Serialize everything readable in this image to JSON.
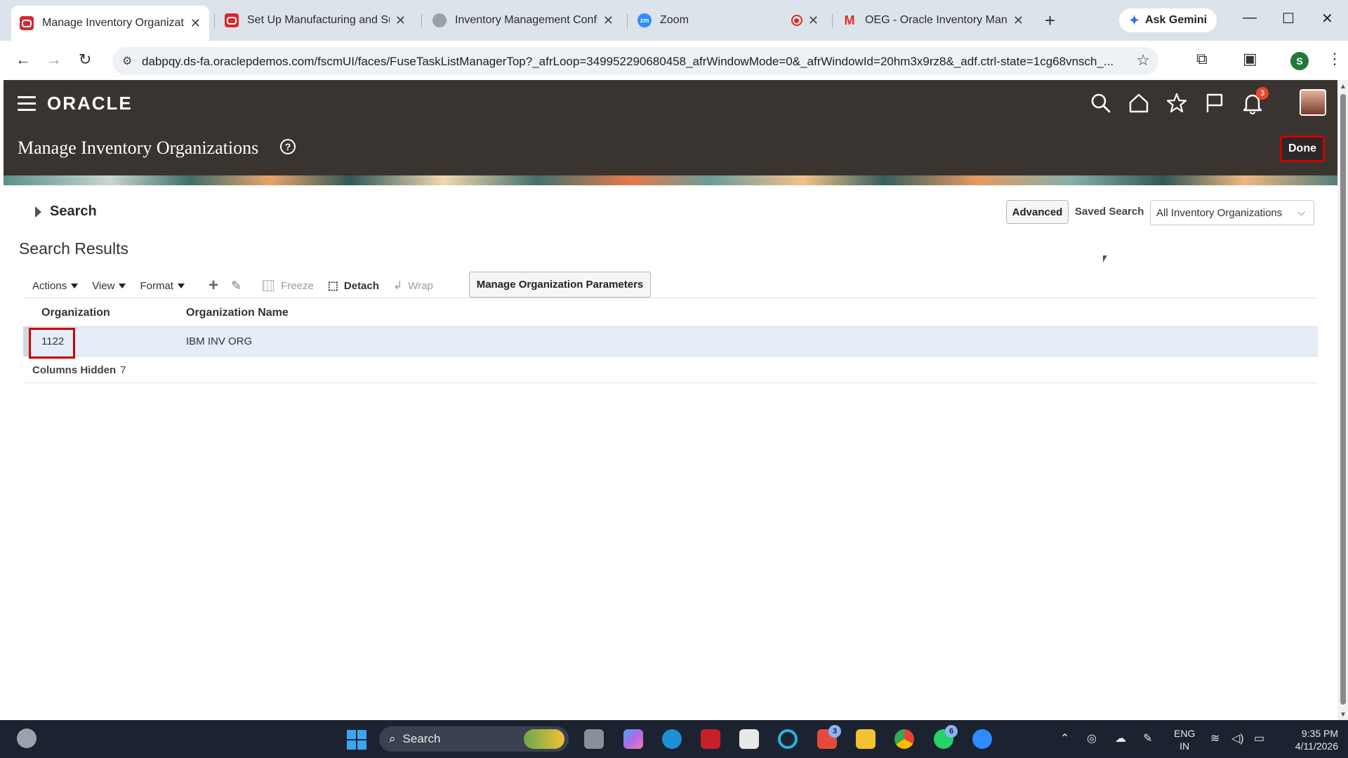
{
  "browser": {
    "tabs": [
      {
        "label": "Manage Inventory Organizatio",
        "active": true
      },
      {
        "label": "Set Up Manufacturing and Sup",
        "active": false
      },
      {
        "label": "Inventory Management Config",
        "active": false
      },
      {
        "label": "Zoom",
        "active": false
      },
      {
        "label": "OEG - Oracle Inventory Manag",
        "active": false
      }
    ],
    "close_glyph": "✕",
    "new_tab_glyph": "+",
    "gemini_label": "Ask Gemini",
    "url": "dabpqy.ds-fa.oraclepdemos.com/fscmUI/faces/FuseTaskListManagerTop?_afrLoop=349952290680458_afrWindowMode=0&_afrWindowId=20hm3x9rz8&_adf.ctrl-state=1cg68vnsch_...",
    "profile_initial": "S"
  },
  "oracle": {
    "logo": "ORACLE",
    "notification_count": "3",
    "page_title": "Manage Inventory Organizations",
    "help_glyph": "?",
    "done_label": "Done"
  },
  "search": {
    "section_label": "Search",
    "advanced_label": "Advanced",
    "saved_search_label": "Saved Search",
    "saved_search_value": "All Inventory Organizations"
  },
  "results": {
    "title": "Search Results",
    "toolbar": {
      "actions": "Actions",
      "view": "View",
      "format": "Format",
      "freeze": "Freeze",
      "detach": "Detach",
      "wrap": "Wrap"
    },
    "manage_params_label": "Manage Organization Parameters",
    "columns": [
      "Organization",
      "Organization Name"
    ],
    "rows": [
      {
        "organization": "1122",
        "organization_name": "IBM INV ORG"
      }
    ],
    "columns_hidden_label": "Columns Hidden",
    "columns_hidden_count": "7"
  },
  "taskbar": {
    "search_label": "Search",
    "badge_l": "3",
    "badge_whatsapp": "6",
    "lang_line1": "ENG",
    "lang_line2": "IN",
    "time": "9:35 PM",
    "date": "4/11/2026"
  },
  "colors": {
    "oracle_header": "#3a3431",
    "highlight": "#cc0000",
    "selected_row": "#e4edf8"
  }
}
